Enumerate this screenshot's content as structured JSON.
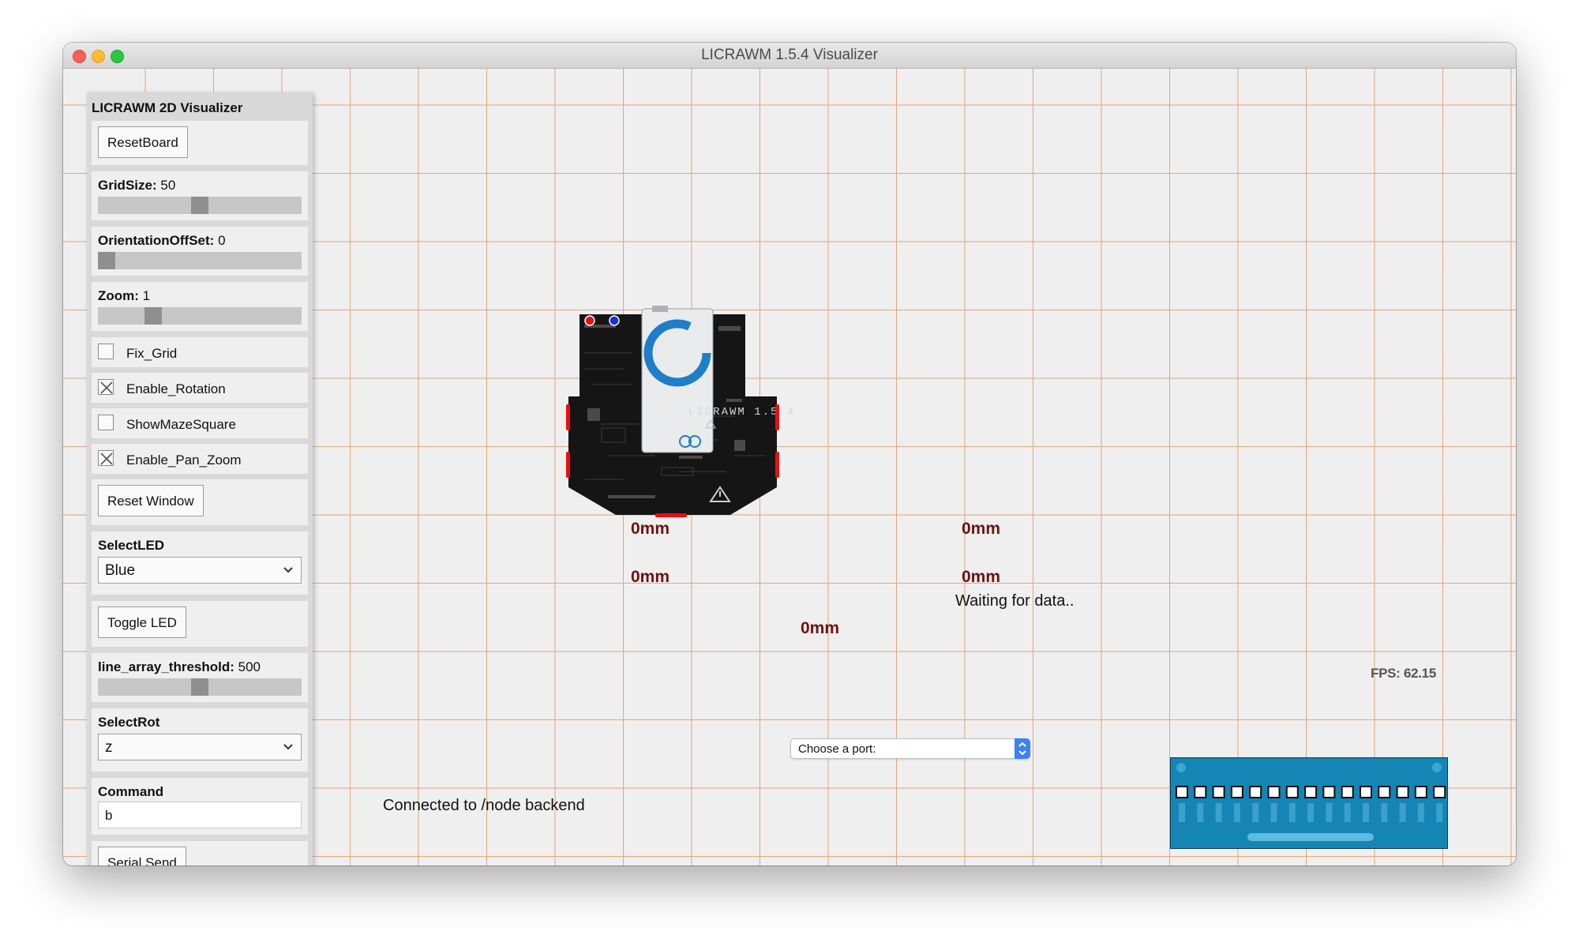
{
  "window": {
    "title": "LICRAWM 1.5.4 Visualizer"
  },
  "panel": {
    "title": "LICRAWM 2D Visualizer",
    "reset_board": "ResetBoard",
    "grid_size": {
      "label": "GridSize:",
      "value": "50",
      "fraction": 0.5
    },
    "orientation_offset": {
      "label": "OrientationOffSet:",
      "value": "0",
      "fraction": 0.0
    },
    "zoom": {
      "label": "Zoom:",
      "value": "1",
      "fraction": 0.25
    },
    "checkboxes": [
      {
        "label": "Fix_Grid",
        "checked": false
      },
      {
        "label": "Enable_Rotation",
        "checked": true
      },
      {
        "label": "ShowMazeSquare",
        "checked": false
      },
      {
        "label": "Enable_Pan_Zoom",
        "checked": true
      }
    ],
    "reset_window": "Reset Window",
    "select_led": {
      "label": "SelectLED",
      "value": "Blue"
    },
    "toggle_led": "Toggle LED",
    "line_array_threshold": {
      "label": "line_array_threshold:",
      "value": "500",
      "fraction": 0.5
    },
    "select_rot": {
      "label": "SelectRot",
      "value": "z"
    },
    "command": {
      "label": "Command",
      "value": "b"
    },
    "serial_send": "Serial Send"
  },
  "board": {
    "label": "LICRAWM 1.5.4",
    "sensor_readings": {
      "left_top": "0mm",
      "left_bottom": "0mm",
      "right_top": "0mm",
      "right_bottom": "0mm",
      "bottom": "0mm"
    }
  },
  "status": {
    "waiting": "Waiting for data..",
    "connected": "Connected to /node backend",
    "fps": "FPS: 62.15"
  },
  "port_select": {
    "placeholder": "Choose a port:"
  },
  "colors": {
    "grid_line": "#e3a57a",
    "canvas": "#efefef",
    "board": "#151515",
    "sensor": "#ee0d0d",
    "line_array": "#1585b5"
  }
}
